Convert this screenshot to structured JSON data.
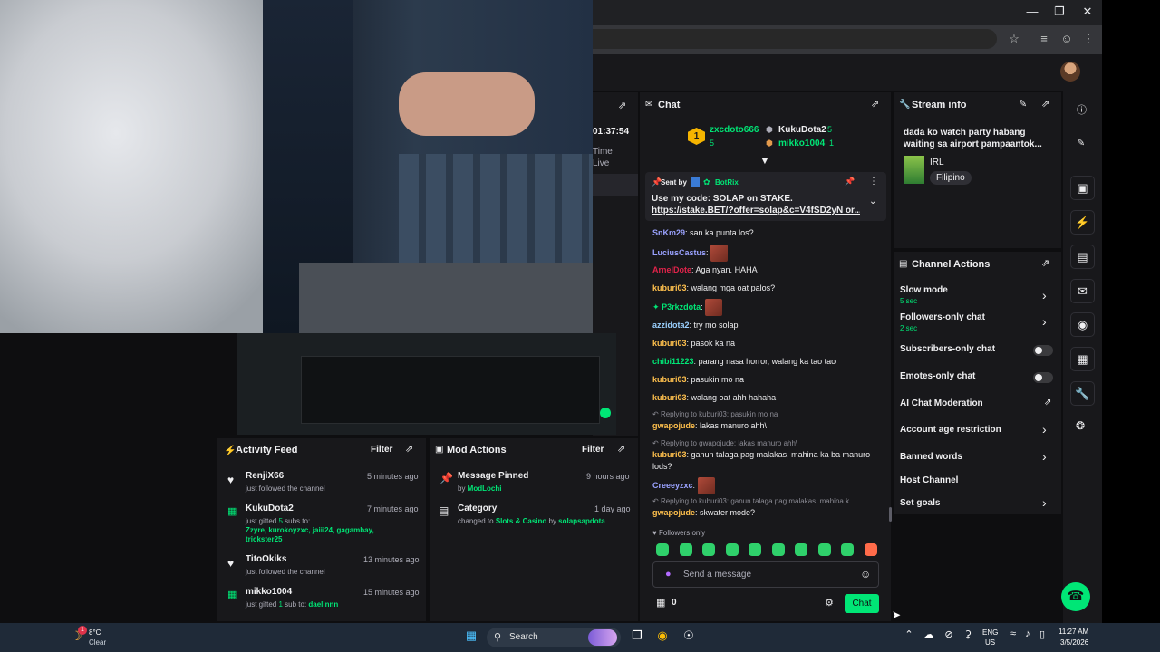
{
  "colors": {
    "accent": "#00e676",
    "panel": "#18181b",
    "bg": "#0e0e10",
    "taskbar": "#1f2a38"
  },
  "video": {
    "timer": "01:37:54",
    "time_label": "Time",
    "live_label": "Live"
  },
  "chat": {
    "title": "Chat",
    "leaders": [
      {
        "rank": "1",
        "name": "zxcdoto666",
        "count": "5"
      },
      {
        "name": "KukuDota2",
        "count": "5"
      },
      {
        "name": "mikko1004",
        "count": "1"
      }
    ],
    "pinned": {
      "sent_by": "Sent by",
      "bot": "BotRix",
      "text": "Use my code: SOLAP on STAKE.",
      "link": "https://stake.BET/?offer=solap&c=V4fSD2yN or..."
    },
    "messages": [
      {
        "user": "SnKm29",
        "text": "san ka punta los?"
      },
      {
        "user": "LuciusCastus",
        "text": ""
      },
      {
        "user": "ArnelDote",
        "text": "Aga nyan. HAHA"
      },
      {
        "user": "kuburi03",
        "text": "walang mga oat palos?"
      },
      {
        "user": "P3rkzdota",
        "text": ""
      },
      {
        "user": "azzidota2",
        "text": "try mo solap"
      },
      {
        "user": "kuburi03",
        "text": "pasok ka na"
      },
      {
        "user": "chibi11223",
        "text": "parang nasa horror, walang ka tao tao"
      },
      {
        "user": "kuburi03",
        "text": "pasukin mo na"
      },
      {
        "user": "kuburi03",
        "text": "walang oat ahh hahaha"
      },
      {
        "reply": "Replying to kuburi03: pasukin mo na",
        "user": "gwapojude",
        "text": "lakas manuro ahh\\"
      },
      {
        "reply": "Replying to gwapojude: lakas manuro ahh\\",
        "user": "kuburi03",
        "text": "ganun talaga pag malakas, mahina ka ba manuro",
        "text2": "lods?"
      },
      {
        "user": "Creeeyzxc",
        "text": ""
      },
      {
        "reply": "Replying to kuburi03: ganun talaga pag malakas, mahina k...",
        "user": "gwapojude",
        "text": "skwater mode?"
      }
    ],
    "followers_only": "Followers only",
    "input_placeholder": "Send a message",
    "points": "0",
    "send_label": "Chat"
  },
  "stream_info": {
    "title": "Stream info",
    "stream_title": "dada ko watch party habang",
    "stream_title_2": "waiting sa airport pampaantok...",
    "category": "IRL",
    "tag": "Filipino"
  },
  "channel_actions": {
    "title": "Channel Actions",
    "items": [
      {
        "label": "Slow mode",
        "sub": "5 sec"
      },
      {
        "label": "Followers-only chat",
        "sub": "2 sec"
      },
      {
        "label": "Subscribers-only chat"
      },
      {
        "label": "Emotes-only chat"
      },
      {
        "label": "AI Chat Moderation"
      },
      {
        "label": "Account age restriction"
      },
      {
        "label": "Banned words"
      },
      {
        "label": "Host Channel"
      },
      {
        "label": "Set goals"
      }
    ]
  },
  "activity_feed": {
    "title": "Activity Feed",
    "filter": "Filter",
    "items": [
      {
        "name": "RenjiX66",
        "time": "5 minutes ago",
        "desc": "just followed the channel"
      },
      {
        "name": "KukuDota2",
        "time": "7 minutes ago",
        "desc_pre": "just gifted ",
        "desc_num": "5",
        "desc_post": " subs to:",
        "recipients": "Zzyre, kurokoyzxc, jaiii24, gagambay,",
        "recipients2": "trickster25"
      },
      {
        "name": "TitoOkiks",
        "time": "13 minutes ago",
        "desc": "just followed the channel"
      },
      {
        "name": "mikko1004",
        "time": "15 minutes ago",
        "desc_pre": "just gifted ",
        "desc_num": "1",
        "desc_post": " sub to: ",
        "recipients": "daelinnn"
      }
    ]
  },
  "mod_actions": {
    "title": "Mod Actions",
    "filter": "Filter",
    "items": [
      {
        "title": "Message Pinned",
        "time": "9 hours ago",
        "by_pre": "by ",
        "by": "ModLochi"
      },
      {
        "title": "Category",
        "time": "1 day ago",
        "by_pre": "changed to ",
        "by": "Slots & Casino",
        "by_mid": " by ",
        "by2": "solapsapdota"
      }
    ]
  },
  "taskbar": {
    "weather_temp": "8°C",
    "weather_desc": "Clear",
    "search": "Search",
    "lang": "ENG",
    "region": "US",
    "time": "11:27 AM",
    "date": "3/5/2026",
    "badge": "1"
  }
}
